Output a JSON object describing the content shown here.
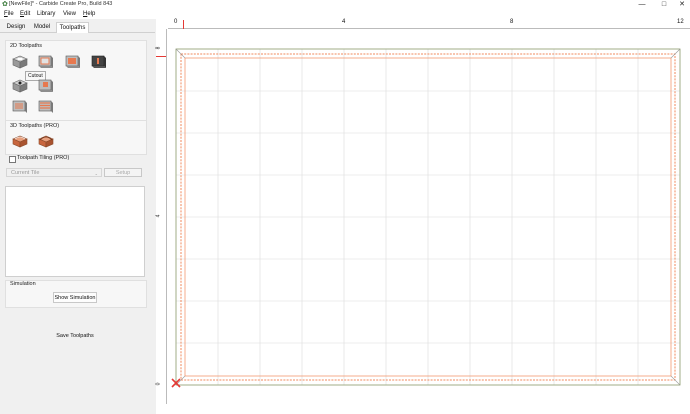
{
  "window": {
    "title": "[NewFile]* - Carbide Create Pro, Build 843",
    "app_icon": "carbide-logo-icon",
    "controls": {
      "minimize": "—",
      "maximize": "□",
      "close": "✕"
    }
  },
  "menu": [
    {
      "key": "F",
      "rest": "ile"
    },
    {
      "key": "E",
      "rest": "dit"
    },
    {
      "key": "",
      "rest": "Library"
    },
    {
      "key": "",
      "rest": "View"
    },
    {
      "key": "H",
      "rest": "elp"
    }
  ],
  "tabs": [
    "Design",
    "Model",
    "Toolpaths"
  ],
  "active_tab": "Toolpaths",
  "panel": {
    "toolpaths_2d": {
      "title": "2D Toolpaths",
      "tools": [
        "contour-toolpath-icon",
        "cutout-toolpath-icon",
        "pocket-toolpath-icon",
        "vcarve-toolpath-icon",
        "drill-toolpath-icon",
        "advanced-vcarve-icon",
        "texture-toolpath-icon",
        "rough-toolpath-icon"
      ],
      "tooltip": "Cutout"
    },
    "toolpaths_3d": {
      "title": "3D Toolpaths (PRO)",
      "tools": [
        "3d-rough-icon",
        "3d-finish-icon"
      ]
    },
    "tiling": {
      "checkbox_label": "Toolpath Tiling (PRO)",
      "checked": false,
      "tile_select": "Current Tile",
      "setup_button": "Setup"
    },
    "simulation": {
      "title": "Simulation",
      "show_button": "Show Simulation"
    },
    "save_button": "Save Toolpaths"
  },
  "rulers": {
    "top": [
      "0",
      "4",
      "8",
      "12"
    ],
    "left": [
      "8",
      "4",
      "0"
    ]
  },
  "colors": {
    "accent_red": "#e53935",
    "toolpath_orange": "#f08a5d",
    "stock_border": "#8a9a6a",
    "grid": "#d8d8d8"
  }
}
